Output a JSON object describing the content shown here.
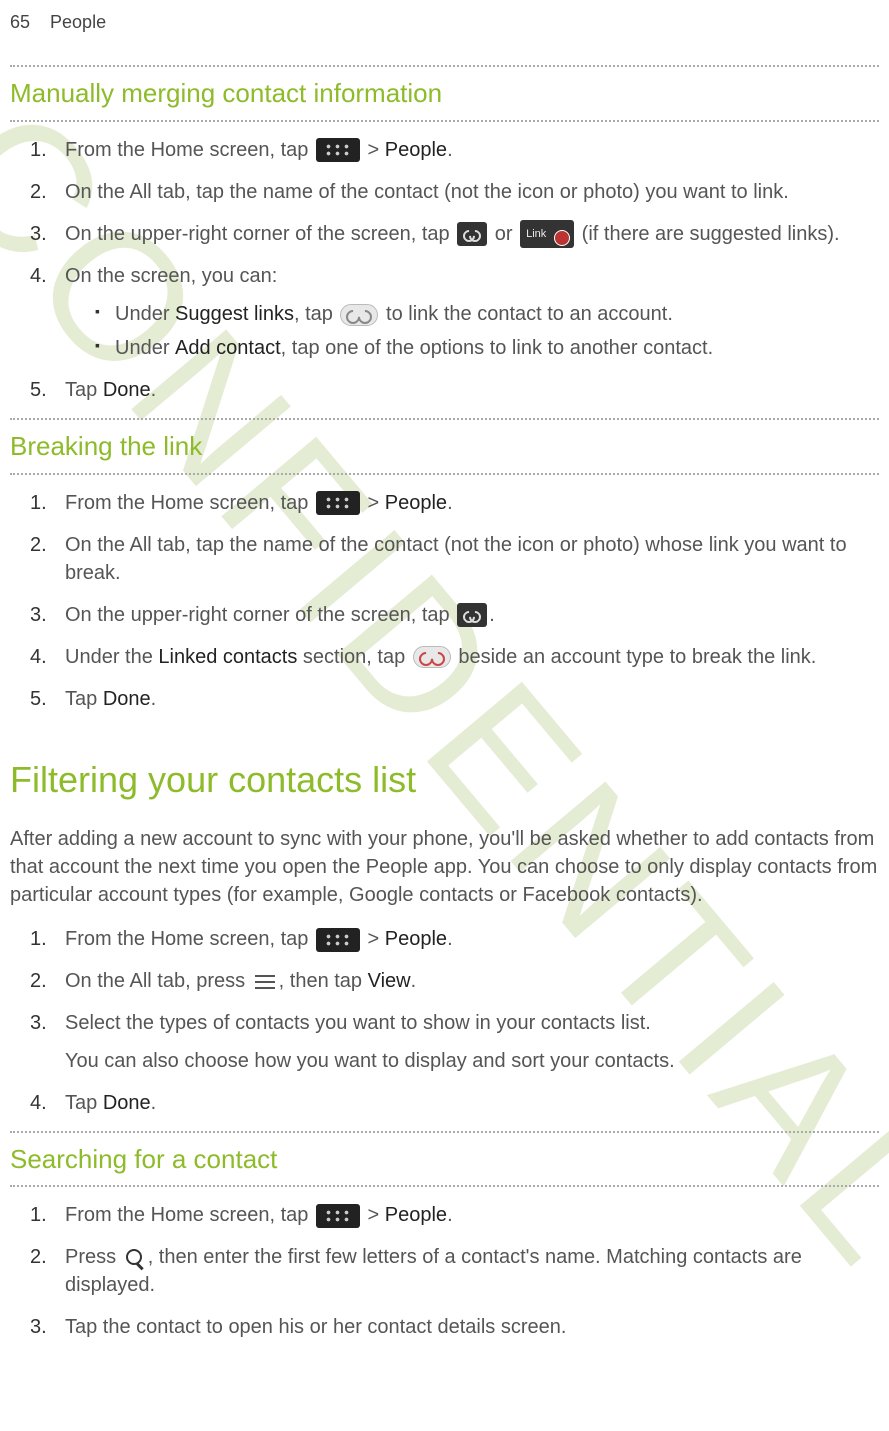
{
  "header": {
    "page_number": "65",
    "section": "People"
  },
  "watermark": "CONFIDENTIAL",
  "sec1": {
    "title": "Manually merging contact information",
    "steps": [
      {
        "n": "1.",
        "pre": "From the Home screen, tap ",
        "post": " > ",
        "bold": "People",
        "tail": "."
      },
      {
        "n": "2.",
        "text": "On the All tab, tap the name of the contact (not the icon or photo) you want to link."
      },
      {
        "n": "3.",
        "pre": "On the upper-right corner of the screen, tap ",
        "mid": " or ",
        "post": " (if there are suggested links)."
      },
      {
        "n": "4.",
        "text": "On the screen, you can:",
        "bullets": [
          {
            "pre": "Under ",
            "bold": "Suggest links",
            "mid": ", tap ",
            "post": " to link the contact to an account."
          },
          {
            "pre": "Under ",
            "bold": "Add contact",
            "post": ", tap one of the options to link to another contact."
          }
        ]
      },
      {
        "n": "5.",
        "pre": "Tap ",
        "bold": "Done",
        "tail": "."
      }
    ]
  },
  "sec2": {
    "title": "Breaking the link",
    "steps": [
      {
        "n": "1.",
        "pre": "From the Home screen, tap ",
        "post": " > ",
        "bold": "People",
        "tail": "."
      },
      {
        "n": "2.",
        "text": "On the All tab, tap the name of the contact (not the icon or photo) whose link you want to break."
      },
      {
        "n": "3.",
        "pre": "On the upper-right corner of the screen, tap ",
        "tail": "."
      },
      {
        "n": "4.",
        "pre": "Under the ",
        "bold": "Linked contacts",
        "mid": " section, tap ",
        "post": " beside an account type to break the link."
      },
      {
        "n": "5.",
        "pre": "Tap ",
        "bold": "Done",
        "tail": "."
      }
    ]
  },
  "sec3": {
    "title": "Filtering your contacts list",
    "intro": "After adding a new account to sync with your phone, you'll be asked whether to add contacts from that account the next time you open the People app. You can choose to only display contacts from particular account types (for example, Google contacts or Facebook contacts).",
    "steps": [
      {
        "n": "1.",
        "pre": "From the Home screen, tap ",
        "post": " > ",
        "bold": "People",
        "tail": "."
      },
      {
        "n": "2.",
        "pre": "On the All tab, press ",
        "mid": ", then tap ",
        "bold": "View",
        "tail": "."
      },
      {
        "n": "3.",
        "text": "Select the types of contacts you want to show in your contacts list.",
        "secondary": "You can also choose how you want to display and sort your contacts."
      },
      {
        "n": "4.",
        "pre": "Tap ",
        "bold": "Done",
        "tail": "."
      }
    ]
  },
  "sec4": {
    "title": "Searching for a contact",
    "steps": [
      {
        "n": "1.",
        "pre": "From the Home screen, tap ",
        "post": " > ",
        "bold": "People",
        "tail": "."
      },
      {
        "n": "2.",
        "pre": "Press ",
        "post": ", then enter the first few letters of a contact's name. Matching contacts are displayed."
      },
      {
        "n": "3.",
        "text": "Tap the contact to open his or her contact details screen."
      }
    ]
  },
  "link_label": "Link"
}
